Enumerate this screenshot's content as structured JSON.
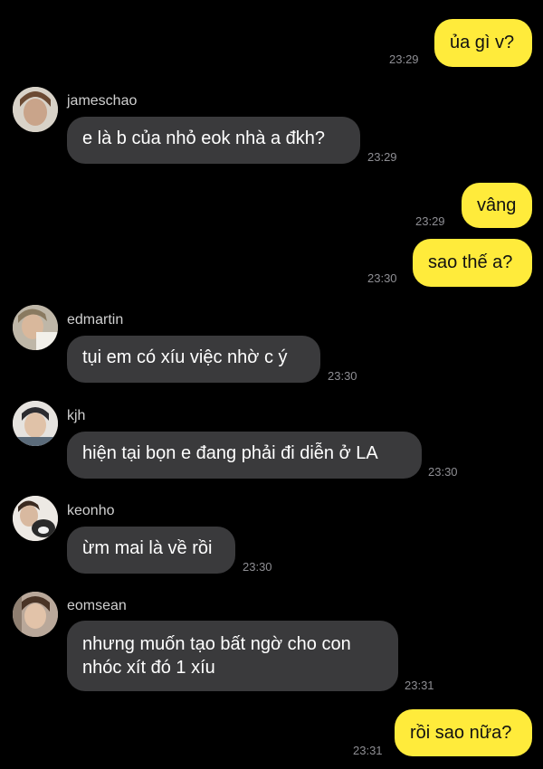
{
  "messages": [
    {
      "id": 1,
      "direction": "out",
      "text": "ủa gì v?",
      "time": "23:29"
    },
    {
      "id": 2,
      "direction": "in",
      "sender": "jameschao",
      "text": "e là b của nhỏ eok nhà a đkh?",
      "time": "23:29"
    },
    {
      "id": 3,
      "direction": "out",
      "text": "vâng",
      "time": "23:29"
    },
    {
      "id": 4,
      "direction": "out",
      "text": "sao thế a?",
      "time": "23:30"
    },
    {
      "id": 5,
      "direction": "in",
      "sender": "edmartin",
      "text": "tụi em có xíu việc nhờ c ý",
      "time": "23:30"
    },
    {
      "id": 6,
      "direction": "in",
      "sender": "kjh",
      "text": "hiện tại bọn e đang phải đi diễn ở LA",
      "time": "23:30"
    },
    {
      "id": 7,
      "direction": "in",
      "sender": "keonho",
      "text": "ừm mai là về rồi",
      "time": "23:30"
    },
    {
      "id": 8,
      "direction": "in",
      "sender": "eomsean",
      "text": "nhưng muốn tạo bất ngờ cho con nhóc xít đó 1 xíu",
      "time": "23:31"
    },
    {
      "id": 9,
      "direction": "out",
      "text": "rồi sao nữa?",
      "time": "23:31"
    }
  ],
  "colors": {
    "background": "#000000",
    "outgoing_bubble": "#FFEB3B",
    "incoming_bubble": "#3a3a3c",
    "timestamp": "#8e8e93"
  }
}
